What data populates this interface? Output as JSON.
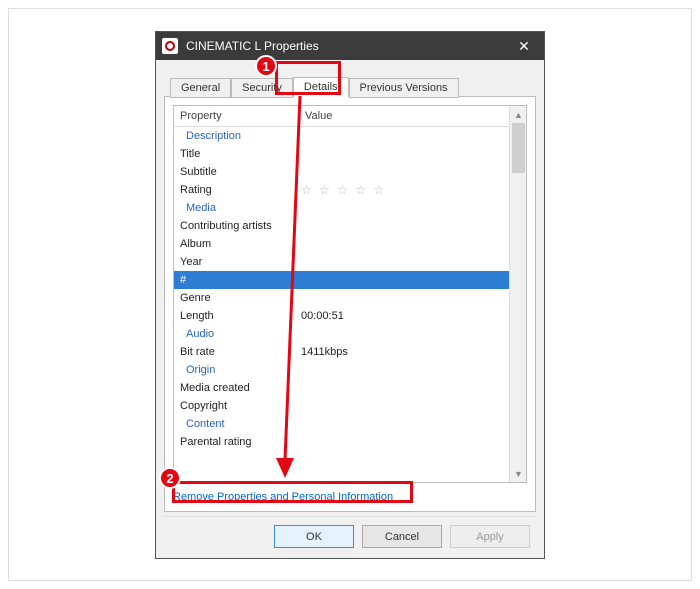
{
  "window": {
    "title": "CINEMATIC     L Properties",
    "close_glyph": "✕"
  },
  "tabs": [
    {
      "label": "General"
    },
    {
      "label": "Security"
    },
    {
      "label": "Details"
    },
    {
      "label": "Previous Versions"
    }
  ],
  "active_tab_index": 2,
  "grid": {
    "columns": {
      "property": "Property",
      "value": "Value"
    },
    "rows": [
      {
        "type": "group",
        "prop": "Description",
        "val": ""
      },
      {
        "type": "item",
        "prop": "Title",
        "val": ""
      },
      {
        "type": "item",
        "prop": "Subtitle",
        "val": ""
      },
      {
        "type": "item",
        "prop": "Rating",
        "val": "☆ ☆ ☆ ☆ ☆",
        "stars": true
      },
      {
        "type": "group",
        "prop": "Media",
        "val": ""
      },
      {
        "type": "item",
        "prop": "Contributing artists",
        "val": ""
      },
      {
        "type": "item",
        "prop": "Album",
        "val": ""
      },
      {
        "type": "item",
        "prop": "Year",
        "val": ""
      },
      {
        "type": "item",
        "prop": "#",
        "val": "",
        "selected": true
      },
      {
        "type": "item",
        "prop": "Genre",
        "val": ""
      },
      {
        "type": "item",
        "prop": "Length",
        "val": "00:00:51"
      },
      {
        "type": "group",
        "prop": "Audio",
        "val": ""
      },
      {
        "type": "item",
        "prop": "Bit rate",
        "val": "1411kbps"
      },
      {
        "type": "group",
        "prop": "Origin",
        "val": ""
      },
      {
        "type": "item",
        "prop": "Media created",
        "val": ""
      },
      {
        "type": "item",
        "prop": "Copyright",
        "val": ""
      },
      {
        "type": "group",
        "prop": "Content",
        "val": ""
      },
      {
        "type": "item",
        "prop": "Parental rating",
        "val": ""
      }
    ]
  },
  "link": {
    "remove": "Remove Properties and Personal Information"
  },
  "buttons": {
    "ok": "OK",
    "cancel": "Cancel",
    "apply": "Apply"
  },
  "annotations": {
    "num1": "1",
    "num2": "2"
  }
}
